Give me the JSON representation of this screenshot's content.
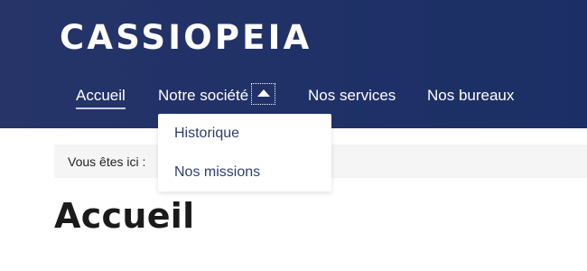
{
  "header": {
    "logo_text": "CASSIOPEIA",
    "background_color": "#1f3167"
  },
  "nav": {
    "items": [
      {
        "label": "Accueil",
        "active": true
      },
      {
        "label": "Notre société",
        "expanded": true
      },
      {
        "label": "Nos services"
      },
      {
        "label": "Nos bureaux"
      }
    ],
    "toggle_icon": "caret-up-icon"
  },
  "dropdown": {
    "items": [
      {
        "label": "Historique"
      },
      {
        "label": "Nos missions"
      }
    ]
  },
  "breadcrumb": {
    "label": "Vous êtes ici :"
  },
  "main": {
    "title": "Accueil"
  }
}
